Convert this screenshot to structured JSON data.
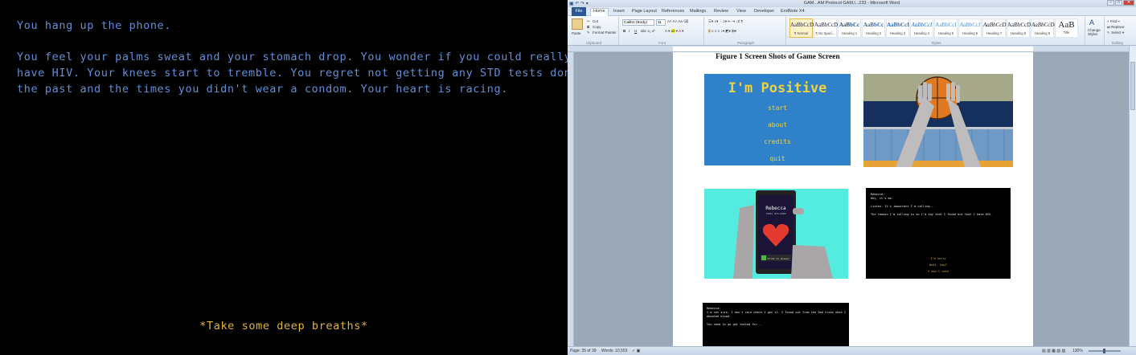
{
  "game": {
    "lines": [
      "You hang up the phone.",
      "You feel your palms sweat and your stomach drop. You wonder if you could really",
      "have HIV. Your knees start to tremble. You regret not getting any STD tests done in",
      "the past and the times you didn't wear a condom. Your heart is racing."
    ],
    "choice": "*Take some deep breaths*",
    "colors": {
      "text": "#5f8fd6",
      "choice": "#e0b43a",
      "background": "#000000"
    }
  },
  "word": {
    "title": "GAM...AM Protocol GAM.l...233 - Microsoft Word",
    "tabs": [
      "File",
      "Home",
      "Insert",
      "Page Layout",
      "References",
      "Mailings",
      "Review",
      "View",
      "Developer",
      "EndNote X4"
    ],
    "ribbon": {
      "paste": "Paste",
      "cut": "Cut",
      "copy": "Copy",
      "format_painter": "Format Painter",
      "clipboard": "Clipboard",
      "font_name": "Calibri (Body)",
      "font_size": "11",
      "font": "Font",
      "paragraph": "Paragraph",
      "styles_group": "Styles",
      "editing_group": "Editing",
      "find": "Find",
      "replace": "Replace",
      "select": "Select",
      "change_styles": "Change Styles",
      "styles": [
        {
          "sample": "AaBbCcDc",
          "name": "¶ Normal"
        },
        {
          "sample": "AaBbCcDc",
          "name": "¶ No Spaci..."
        },
        {
          "sample": "AaBbCc",
          "name": "Heading 1"
        },
        {
          "sample": "AaBbCc",
          "name": "Heading 2"
        },
        {
          "sample": "AaBbCcI",
          "name": "Heading 3"
        },
        {
          "sample": "AaBbCcI",
          "name": "Heading 4"
        },
        {
          "sample": "AaBbCcI",
          "name": "Heading 5"
        },
        {
          "sample": "AaBbCcI",
          "name": "Heading 6"
        },
        {
          "sample": "AaBbCcD",
          "name": "Heading 7"
        },
        {
          "sample": "AaBbCcD",
          "name": "Heading 8"
        },
        {
          "sample": "AaBbCcDc",
          "name": "Heading 9"
        },
        {
          "sample": "AaB",
          "name": "Title"
        }
      ]
    },
    "document": {
      "caption": "Figure 1 Screen Shots of Game Screen",
      "title_screen": {
        "heading": "I'm Positive",
        "menu": [
          "start",
          "about",
          "credits",
          "quit"
        ]
      },
      "phone_screen": {
        "caller": "Rebecca",
        "number": "(555) 913-5402",
        "action": "Slide to answer"
      },
      "text_screen": {
        "lines": [
          "Rebecca:",
          "Hey, it's me.",
          "",
          "Listen. It's important I'm calling...",
          "",
          "The reason I'm calling is so I'd say that I found out that I have HIV."
        ],
        "options": [
          "I'm sorry",
          "Wait, how?",
          "I don't care"
        ]
      },
      "bottom_screen": {
        "lines": [
          "Rebecca:",
          "I'm not sure, I don't care where I got it. I found out from the Red Cross when I",
          "donated blood.",
          "",
          "You need to go get tested for..."
        ]
      }
    },
    "status": {
      "page": "Page: 35 of 39",
      "words": "Words: 10,553",
      "zoom": "130%"
    },
    "colors": {
      "file_tab": "#2b5797",
      "title_screen_bg": "#2f82c9",
      "title_text": "#f0d23c",
      "phone_bg": "#55ece0"
    }
  }
}
